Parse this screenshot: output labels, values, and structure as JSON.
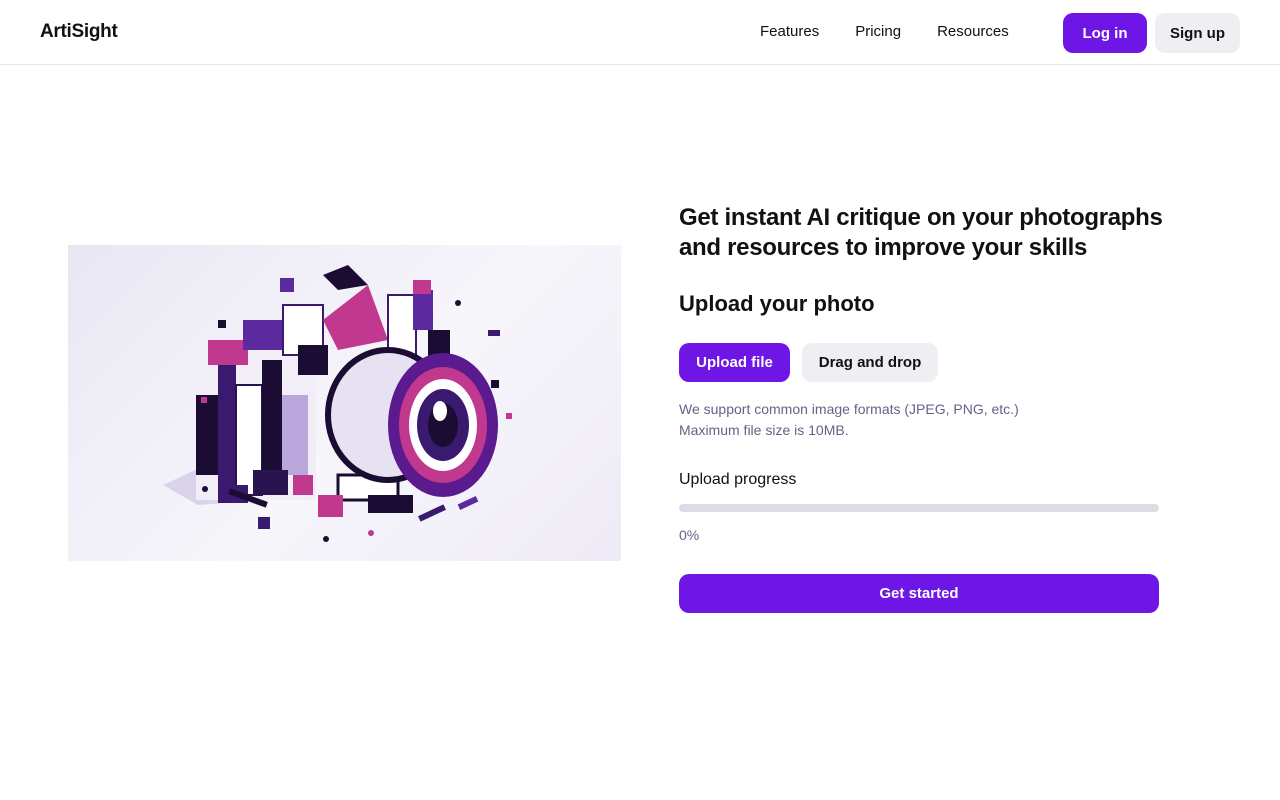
{
  "brand": {
    "name": "ArtiSight"
  },
  "nav": {
    "links": [
      "Features",
      "Pricing",
      "Resources"
    ],
    "login_label": "Log in",
    "signup_label": "Sign up"
  },
  "hero": {
    "headline": "Get instant AI critique on your photographs and resources to improve your skills",
    "image_icon": "isometric-camera-illustration-icon"
  },
  "upload": {
    "title": "Upload your photo",
    "upload_file_label": "Upload file",
    "drag_drop_label": "Drag and drop",
    "support_text": "We support common image formats (JPEG, PNG, etc.)",
    "max_size_text": "Maximum file size is 10MB.",
    "progress_label": "Upload progress",
    "progress_value": "0%",
    "progress_fraction": 0,
    "cta_label": "Get started"
  },
  "colors": {
    "accent": "#6d16e6",
    "secondary_button": "#efeef3",
    "muted_text": "#6b5f84",
    "progress_track": "#dddce6"
  }
}
